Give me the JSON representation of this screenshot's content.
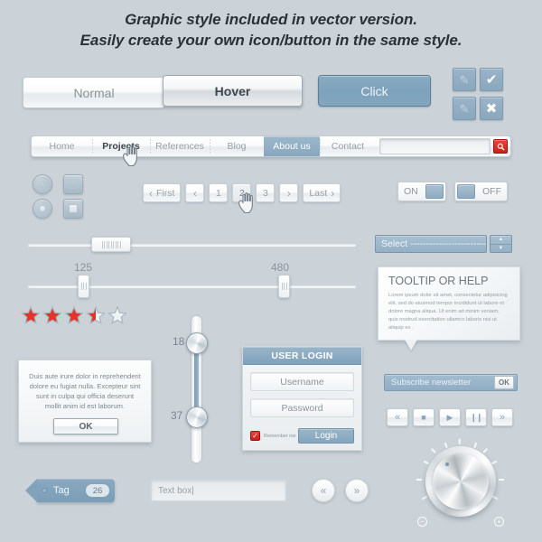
{
  "heading": {
    "line1": "Graphic style included in vector version.",
    "line2": "Easily create your own icon/button in the same style."
  },
  "buttons": {
    "normal": "Normal",
    "hover": "Hover",
    "click": "Click"
  },
  "icon_buttons": [
    {
      "name": "pencil-icon",
      "glyph": "✎",
      "state": "faded"
    },
    {
      "name": "check-icon",
      "glyph": "✔",
      "state": "solid"
    },
    {
      "name": "pencil-alt-icon",
      "glyph": "✎",
      "state": "faded"
    },
    {
      "name": "close-icon",
      "glyph": "✖",
      "state": "solid"
    }
  ],
  "nav": {
    "items": [
      {
        "label": "Home",
        "state": "normal"
      },
      {
        "label": "Projects",
        "state": "hovered"
      },
      {
        "label": "References",
        "state": "normal"
      },
      {
        "label": "Blog",
        "state": "normal"
      },
      {
        "label": "About us",
        "state": "active"
      },
      {
        "label": "Contact",
        "state": "normal"
      }
    ],
    "search_value": "",
    "search_icon": "search-icon"
  },
  "controls": {
    "radio_unchecked": "radio-unchecked",
    "radio_checked": "radio-checked",
    "checkbox_unchecked": "checkbox-unchecked",
    "checkbox_checked": "checkbox-checked"
  },
  "pager": {
    "first": "First",
    "prev": "‹",
    "pages": [
      "1",
      "2",
      "3"
    ],
    "selected": "2",
    "next": "›",
    "last": "Last"
  },
  "toggles": {
    "on_label": "ON",
    "off_label": "OFF"
  },
  "sliders": {
    "top_handle_pct": 24,
    "range_min_label": "125",
    "range_max_label": "480",
    "range_min_pct": 19,
    "range_max_pct": 77
  },
  "rating": {
    "value": 3.5,
    "max": 5,
    "color": "#e5332a"
  },
  "dialog": {
    "text": "Duis aute irure dolor in reprehenderit dolore eu fugiat nulla. Excepteur sint sunt in culpa qui officia deserunt mollit anim id est laborum.",
    "ok": "OK"
  },
  "vertical_slider": {
    "top_label": "18",
    "bottom_label": "37"
  },
  "login": {
    "title": "USER LOGIN",
    "username_placeholder": "Username",
    "password_placeholder": "Password",
    "remember_label": "Remember me",
    "submit": "Login"
  },
  "select": {
    "value": "Select -------------------------",
    "up_arrow": "▲",
    "down_arrow": "▼"
  },
  "tooltip": {
    "title": "TOOLTIP OR HELP",
    "body": "Lorem ipsum dolor sit amet, consectetur adipisicing elit, sed do eiusmod tempor incididunt ut labore et dolore magna aliqua. Ut enim ad minim veniam, quis nostrud exercitation ullamco laboris nisi ut aliquip ex ."
  },
  "subscribe": {
    "value": "Subscribe newsletter",
    "ok": "OK"
  },
  "media": [
    {
      "name": "rewind-button",
      "glyph": "«"
    },
    {
      "name": "stop-button",
      "glyph": "■"
    },
    {
      "name": "play-button",
      "glyph": "▶"
    },
    {
      "name": "pause-button",
      "glyph": "❙❙"
    },
    {
      "name": "fast-forward-button",
      "glyph": "»"
    }
  ],
  "tag": {
    "label": "Tag",
    "count": "26"
  },
  "textbox": {
    "value": "Text box|"
  },
  "round_nav": {
    "prev": "«",
    "next": "»"
  },
  "knob": {
    "minus": "−",
    "plus": "+"
  },
  "colors": {
    "background": "#ccd3d8",
    "accent_blue": "#86a7bf",
    "accent_red": "#c8201a",
    "text": "#6b7780"
  }
}
